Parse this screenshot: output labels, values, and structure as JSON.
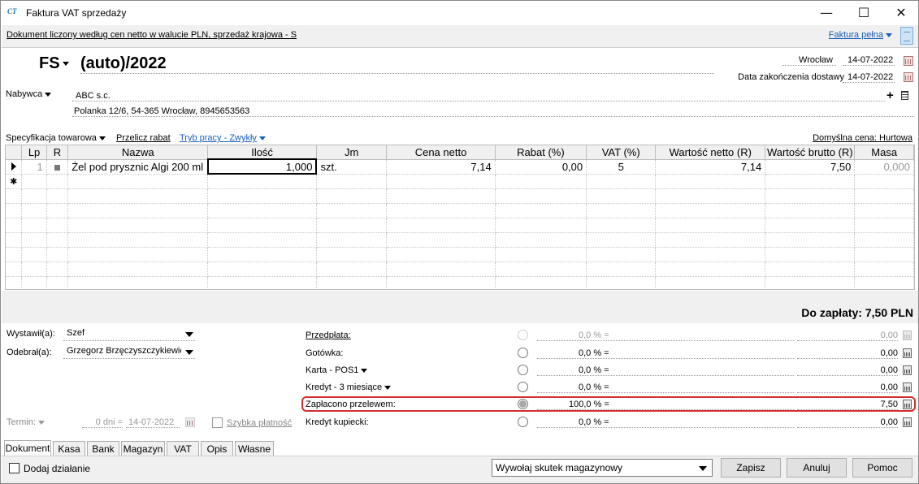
{
  "window": {
    "title": "Faktura VAT sprzedaży",
    "minimize": "—",
    "maximize": "☐",
    "close": "✕"
  },
  "infoband": {
    "doc_mode": "Dokument liczony według cen netto w walucie PLN, sprzedaż krajowa - S",
    "full_invoice": "Faktura pełna"
  },
  "header": {
    "doc_type": "FS",
    "doc_number": "(auto)/2022",
    "city": "Wrocław",
    "issue_date": "14-07-2022",
    "delivery_label": "Data zakończenia dostawy",
    "delivery_date": "14-07-2022"
  },
  "buyer": {
    "label": "Nabywca",
    "name": "ABC s.c.",
    "address": "Polanka  12/6, 54-365 Wrocław, 8945653563",
    "add": "+"
  },
  "toolbar": {
    "spec": "Specyfikacja towarowa",
    "recalc": "Przelicz rabat",
    "mode": "Tryb pracy - Zwykły",
    "default_price": "Domyślna cena: Hurtowa"
  },
  "grid": {
    "columns": [
      "Lp",
      "R",
      "Nazwa",
      "Ilość",
      "Jm",
      "Cena netto",
      "Rabat (%)",
      "VAT (%)",
      "Wartość netto (R)",
      "Wartość brutto (R)",
      "Masa"
    ],
    "rows": [
      {
        "lp": "1",
        "name": "Żel pod prysznic Algi 200 ml",
        "qty": "1,000",
        "unit": "szt.",
        "price": "7,14",
        "discount": "0,00",
        "vat": "5",
        "net": "7,14",
        "gross": "7,50",
        "mass": "0,000"
      }
    ],
    "new_row_marker": "✱"
  },
  "total": "Do zapłaty: 7,50 PLN",
  "people": {
    "issued_label": "Wystawił(a):",
    "issued_value": "Szef",
    "received_label": "Odebrał(a):",
    "received_value": "Grzegorz Brzęczyszczykiewicz"
  },
  "term": {
    "label": "Termin:",
    "days": "0 dni =",
    "date": "14-07-2022",
    "fast_pay": "Szybka płatność"
  },
  "payments": [
    {
      "label": "Przedpłata:",
      "pct": "0,0 % =",
      "amount": "0,00"
    },
    {
      "label": "Gotówka:",
      "pct": "0,0 % =",
      "amount": "0,00"
    },
    {
      "label": "Karta - POS1",
      "pct": "0,0 % =",
      "amount": "0,00"
    },
    {
      "label": "Kredyt - 3 miesiące",
      "pct": "0,0 % =",
      "amount": "0,00"
    },
    {
      "label": "Zapłacono przelewem:",
      "pct": "100,0 % =",
      "amount": "7,50"
    },
    {
      "label": "Kredyt kupiecki:",
      "pct": "0,0 % =",
      "amount": "0,00"
    }
  ],
  "tabs": [
    "Dokument",
    "Kasa",
    "Bank",
    "Magazyn",
    "VAT",
    "Opis",
    "Własne"
  ],
  "footer": {
    "add_action": "Dodaj działanie",
    "warehouse_effect": "Wywołaj skutek magazynowy",
    "save": "Zapisz",
    "cancel": "Anuluj",
    "help": "Pomoc"
  }
}
